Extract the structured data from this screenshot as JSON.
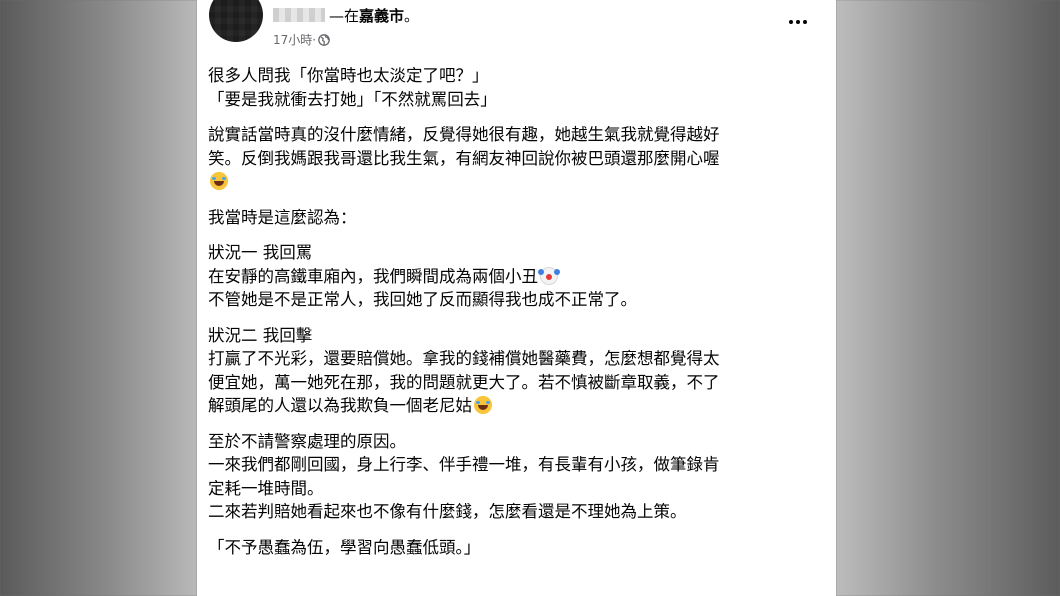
{
  "post": {
    "author_suffix": "—在",
    "location": "嘉義市",
    "location_end": "。",
    "time": "17小時",
    "time_sep": " · ",
    "privacy_icon": "globe-icon",
    "more_icon": "more-horizontal-icon",
    "paragraphs": [
      [
        "很多人問我「你當時也太淡定了吧？」",
        "「要是我就衝去打她」「不然就罵回去」"
      ],
      [
        "說實話當時真的沒什麼情緒，反覺得她很有趣，她越生氣我就覺得越好",
        "笑。反倒我媽跟我哥還比我生氣，有網友神回說你被巴頭還那麼開心喔"
      ],
      [
        "我當時是這麼認為："
      ],
      [
        "狀況一 我回罵",
        "在安靜的高鐵車廂內，我們瞬間成為兩個小丑",
        "不管她是不是正常人，我回她了反而顯得我也成不正常了。"
      ],
      [
        "狀況二 我回擊",
        "打贏了不光彩，還要賠償她。拿我的錢補償她醫藥費，怎麼想都覺得太",
        "便宜她，萬一她死在那，我的問題就更大了。若不慎被斷章取義，不了",
        "解頭尾的人還以為我欺負一個老尼姑"
      ],
      [
        "至於不請警察處理的原因。",
        "一來我們都剛回國，身上行李、伴手禮一堆，有長輩有小孩，做筆錄肯",
        "定耗一堆時間。",
        "二來若判賠她看起來也不像有什麼錢，怎麼看還是不理她為上策。"
      ],
      [
        "「不予愚蠢為伍，學習向愚蠢低頭。」"
      ]
    ],
    "emojis": [
      "laughing-tears-emoji",
      "clown-emoji",
      "laughing-tears-emoji"
    ]
  }
}
